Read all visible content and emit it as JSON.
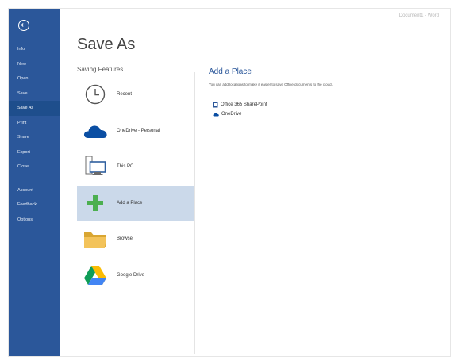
{
  "window": {
    "title": "Document1 - Word"
  },
  "sidebar": {
    "items": [
      {
        "label": "Info"
      },
      {
        "label": "New"
      },
      {
        "label": "Open"
      },
      {
        "label": "Save"
      },
      {
        "label": "Save As",
        "active": true
      },
      {
        "label": "Print"
      },
      {
        "label": "Share"
      },
      {
        "label": "Export"
      },
      {
        "label": "Close"
      }
    ],
    "bottom_items": [
      {
        "label": "Account"
      },
      {
        "label": "Feedback"
      },
      {
        "label": "Options"
      }
    ]
  },
  "main": {
    "title": "Save As",
    "section_label": "Saving Features",
    "places": [
      {
        "label": "Recent",
        "icon": "clock-icon"
      },
      {
        "label": "OneDrive - Personal",
        "icon": "onedrive-cloud-icon"
      },
      {
        "label": "This PC",
        "icon": "computer-icon"
      },
      {
        "label": "Add a Place",
        "icon": "plus-icon",
        "selected": true
      },
      {
        "label": "Browse",
        "icon": "folder-icon"
      },
      {
        "label": "Google Drive",
        "icon": "google-drive-icon"
      }
    ]
  },
  "detail": {
    "title": "Add a Place",
    "description": "You can add locations to make it easier to save Office documents to the cloud.",
    "links": [
      {
        "label": "Office 365 SharePoint",
        "icon": "sharepoint-icon"
      },
      {
        "label": "OneDrive",
        "icon": "onedrive-small-icon"
      }
    ]
  },
  "colors": {
    "sidebar": "#2b579a",
    "selected": "#cbd9ea",
    "accent": "#2b579a"
  }
}
